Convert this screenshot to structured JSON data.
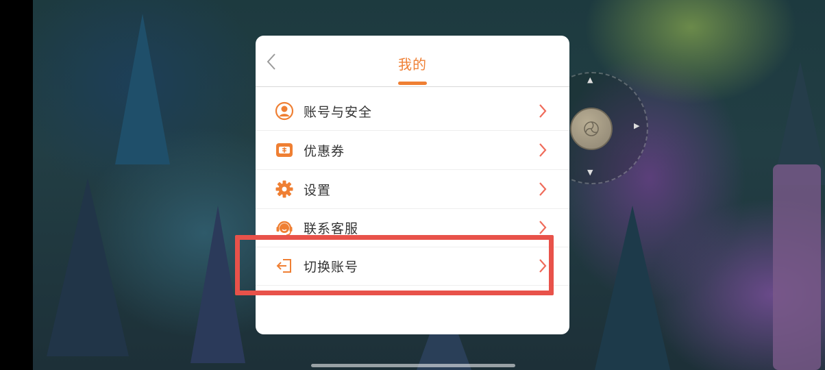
{
  "dialog": {
    "title": "我的",
    "back_icon": "chevron-left-icon",
    "accent_color": "#ef7f33",
    "items": [
      {
        "label": "账号与安全",
        "icon": "user-circle-icon"
      },
      {
        "label": "优惠券",
        "icon": "coupon-icon"
      },
      {
        "label": "设置",
        "icon": "gear-icon"
      },
      {
        "label": "联系客服",
        "icon": "headset-icon"
      },
      {
        "label": "切换账号",
        "icon": "switch-account-icon"
      }
    ]
  },
  "overlay": {
    "highlight_color": "#e8524a",
    "highlighted_item": "切换账号"
  },
  "game": {
    "joystick": "virtual-joystick"
  }
}
